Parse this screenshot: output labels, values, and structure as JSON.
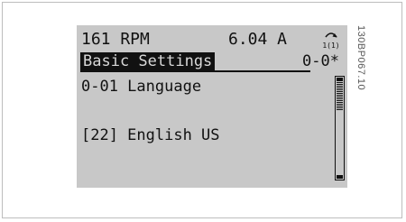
{
  "status": {
    "speed": "161 RPM",
    "current": "6.04 A",
    "icon": "motor-rotation-icon",
    "icon_caption": "1(1)"
  },
  "menu": {
    "title": "Basic Settings",
    "code": "0-0*"
  },
  "parameter": {
    "name": "0-01 Language",
    "value": "[22] English US"
  },
  "scrollbar": {
    "position_fraction": 0.0,
    "visible_fraction": 0.3
  },
  "side_code": "130BP067.10",
  "colors": {
    "lcd_background": "#c8c8c8",
    "lcd_text": "#111111",
    "highlight_background": "#111111",
    "highlight_text": "#d8d8d8"
  }
}
